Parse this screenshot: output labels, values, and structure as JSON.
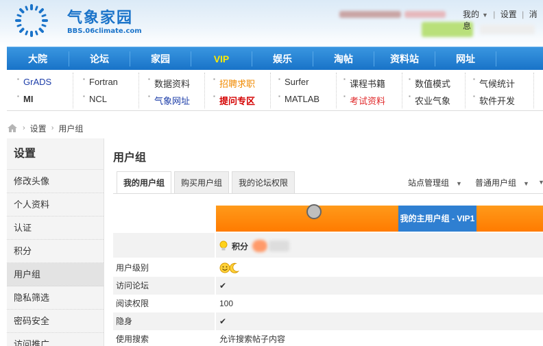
{
  "brand": {
    "logo_text": "气象家园",
    "logo_url_text": "BBS.06climate.com"
  },
  "top_links": [
    "我的",
    "设置",
    "消息"
  ],
  "main_nav": [
    "大院",
    "论坛",
    "家园",
    "VIP",
    "娱乐",
    "淘帖",
    "资料站",
    "网址"
  ],
  "sub_nav": [
    [
      "GrADS",
      "MI"
    ],
    [
      "Fortran",
      "NCL"
    ],
    [
      "数据资料",
      "气象网址"
    ],
    [
      "招聘求职",
      "提问专区"
    ],
    [
      "Surfer",
      "MATLAB"
    ],
    [
      "课程书籍",
      "考试资料"
    ],
    [
      "数值模式",
      "农业气象"
    ],
    [
      "气候统计",
      "软件开发"
    ]
  ],
  "breadcrumb": [
    "设置",
    "用户组"
  ],
  "sidebar": {
    "title": "设置",
    "items": [
      "修改头像",
      "个人资料",
      "认证",
      "积分",
      "用户组",
      "隐私筛选",
      "密码安全",
      "访问推广"
    ],
    "active_index": 4
  },
  "content": {
    "title": "用户组",
    "tabs": [
      "我的用户组",
      "购买用户组",
      "我的论坛权限"
    ],
    "right_links": [
      "站点管理组",
      "普通用户组"
    ],
    "main_group_label": "我的主用户组 - VIP1",
    "score_label": "积分",
    "rows": [
      {
        "label": "用户级别",
        "value": "",
        "icon": "smiley-moon-icon"
      },
      {
        "label": "访问论坛",
        "value": "",
        "icon": "check-icon"
      },
      {
        "label": "阅读权限",
        "value": "100"
      },
      {
        "label": "隐身",
        "value": "",
        "icon": "check-icon"
      },
      {
        "label": "使用搜索",
        "value": "允许搜索帖子内容"
      }
    ]
  },
  "colors": {
    "nav_blue": "#1973c8",
    "accent_orange": "#ff7b00",
    "group_blue": "#2f7fd1",
    "check_green": "#3b9b1d"
  }
}
